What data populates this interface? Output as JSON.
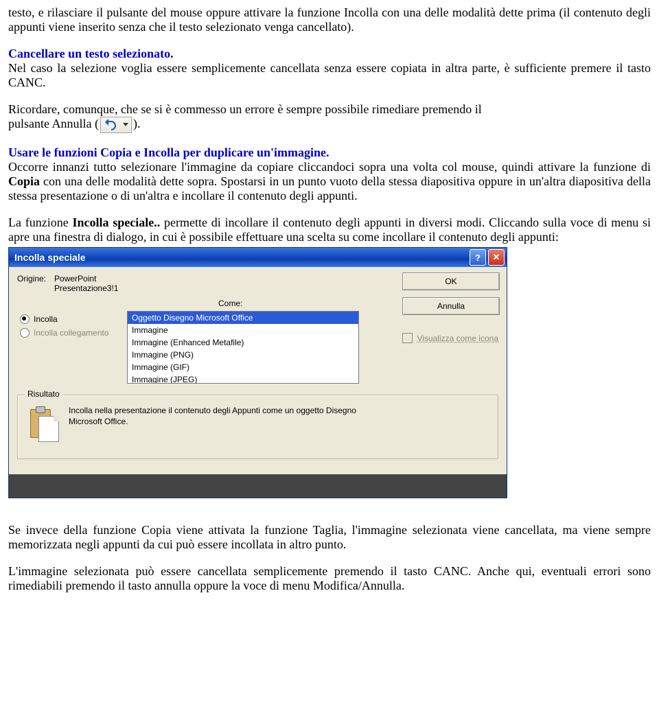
{
  "para": {
    "intro": "testo, e rilasciare il pulsante del mouse oppure attivare la funzione Incolla con una delle modalità dette prima (il contenuto degli appunti viene inserito senza che il testo selezionato venga cancellato).",
    "h_cancel": "Cancellare un testo selezionato.",
    "cancel_body": "Nel caso la selezione voglia essere semplicemente cancellata senza essere copiata in altra parte, è sufficiente premere il tasto CANC.",
    "remember_a": "Ricordare, comunque, che se si è commesso un errore è sempre possibile rimediare premendo il",
    "remember_b_prefix": "pulsante Annulla (",
    "remember_b_suffix": ").",
    "h_copyimg": "Usare le funzioni Copia e Incolla per duplicare un'immagine.",
    "copyimg_body_a": "Occorre innanzi tutto selezionare l'immagine da copiare cliccandoci sopra una volta col mouse, quindi attivare la funzione di ",
    "copyimg_body_bold": "Copia",
    "copyimg_body_b": " con una delle modalità dette sopra. Spostarsi in un punto vuoto della stessa diapositiva oppure in un'altra diapositiva della stessa presentazione o di un'altra e incollare il contenuto degli appunti.",
    "special_a": "La funzione ",
    "special_bold": "Incolla speciale..",
    "special_b": " permette di incollare il contenuto degli appunti in diversi modi. Cliccando sulla voce di menu si apre una finestra di dialogo, in cui è possibile effettuare una scelta su come incollare il contenuto degli appunti:",
    "after1": "Se invece della funzione Copia viene attivata la funzione Taglia, l'immagine selezionata viene cancellata, ma viene sempre memorizzata negli appunti da cui può essere incollata in altro punto.",
    "after2": "L'immagine selezionata può essere cancellata semplicemente premendo il tasto CANC. Anche qui, eventuali errori sono rimediabili premendo il tasto annulla oppure la voce di menu Modifica/Annulla."
  },
  "dialog": {
    "title": "Incolla speciale",
    "origin_label": "Origine:",
    "origin_val1": "PowerPoint",
    "origin_val2": "Presentazione3!1",
    "come_label": "Come:",
    "radio_paste": "Incolla",
    "radio_link": "Incolla collegamento",
    "ok": "OK",
    "cancel": "Annulla",
    "show_icon": "Visualizza come icona",
    "list": {
      "i0": "Oggetto Disegno Microsoft Office",
      "i1": "Immagine",
      "i2": "Immagine (Enhanced Metafile)",
      "i3": "Immagine (PNG)",
      "i4": "Immagine (GIF)",
      "i5": "Immagine (JPEG)"
    },
    "result_legend": "Risultato",
    "result_text": "Incolla nella presentazione il contenuto degli Appunti come un oggetto Disegno Microsoft Office."
  }
}
